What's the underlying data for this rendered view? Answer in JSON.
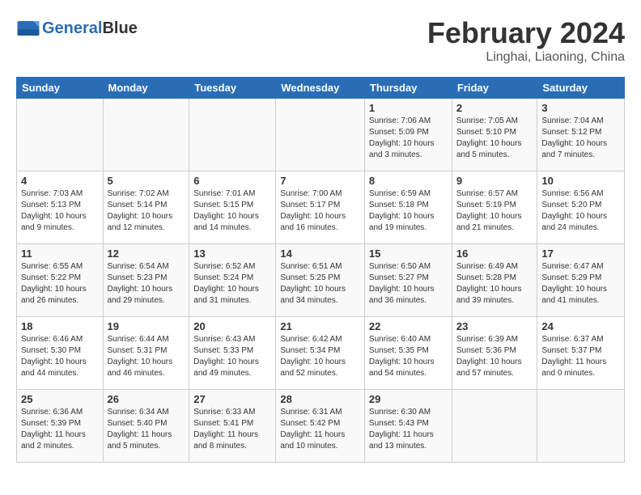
{
  "header": {
    "logo_line1": "General",
    "logo_line2": "Blue",
    "month": "February 2024",
    "location": "Linghai, Liaoning, China"
  },
  "days_of_week": [
    "Sunday",
    "Monday",
    "Tuesday",
    "Wednesday",
    "Thursday",
    "Friday",
    "Saturday"
  ],
  "weeks": [
    [
      {
        "day": "",
        "content": ""
      },
      {
        "day": "",
        "content": ""
      },
      {
        "day": "",
        "content": ""
      },
      {
        "day": "",
        "content": ""
      },
      {
        "day": "1",
        "content": "Sunrise: 7:06 AM\nSunset: 5:09 PM\nDaylight: 10 hours\nand 3 minutes."
      },
      {
        "day": "2",
        "content": "Sunrise: 7:05 AM\nSunset: 5:10 PM\nDaylight: 10 hours\nand 5 minutes."
      },
      {
        "day": "3",
        "content": "Sunrise: 7:04 AM\nSunset: 5:12 PM\nDaylight: 10 hours\nand 7 minutes."
      }
    ],
    [
      {
        "day": "4",
        "content": "Sunrise: 7:03 AM\nSunset: 5:13 PM\nDaylight: 10 hours\nand 9 minutes."
      },
      {
        "day": "5",
        "content": "Sunrise: 7:02 AM\nSunset: 5:14 PM\nDaylight: 10 hours\nand 12 minutes."
      },
      {
        "day": "6",
        "content": "Sunrise: 7:01 AM\nSunset: 5:15 PM\nDaylight: 10 hours\nand 14 minutes."
      },
      {
        "day": "7",
        "content": "Sunrise: 7:00 AM\nSunset: 5:17 PM\nDaylight: 10 hours\nand 16 minutes."
      },
      {
        "day": "8",
        "content": "Sunrise: 6:59 AM\nSunset: 5:18 PM\nDaylight: 10 hours\nand 19 minutes."
      },
      {
        "day": "9",
        "content": "Sunrise: 6:57 AM\nSunset: 5:19 PM\nDaylight: 10 hours\nand 21 minutes."
      },
      {
        "day": "10",
        "content": "Sunrise: 6:56 AM\nSunset: 5:20 PM\nDaylight: 10 hours\nand 24 minutes."
      }
    ],
    [
      {
        "day": "11",
        "content": "Sunrise: 6:55 AM\nSunset: 5:22 PM\nDaylight: 10 hours\nand 26 minutes."
      },
      {
        "day": "12",
        "content": "Sunrise: 6:54 AM\nSunset: 5:23 PM\nDaylight: 10 hours\nand 29 minutes."
      },
      {
        "day": "13",
        "content": "Sunrise: 6:52 AM\nSunset: 5:24 PM\nDaylight: 10 hours\nand 31 minutes."
      },
      {
        "day": "14",
        "content": "Sunrise: 6:51 AM\nSunset: 5:25 PM\nDaylight: 10 hours\nand 34 minutes."
      },
      {
        "day": "15",
        "content": "Sunrise: 6:50 AM\nSunset: 5:27 PM\nDaylight: 10 hours\nand 36 minutes."
      },
      {
        "day": "16",
        "content": "Sunrise: 6:49 AM\nSunset: 5:28 PM\nDaylight: 10 hours\nand 39 minutes."
      },
      {
        "day": "17",
        "content": "Sunrise: 6:47 AM\nSunset: 5:29 PM\nDaylight: 10 hours\nand 41 minutes."
      }
    ],
    [
      {
        "day": "18",
        "content": "Sunrise: 6:46 AM\nSunset: 5:30 PM\nDaylight: 10 hours\nand 44 minutes."
      },
      {
        "day": "19",
        "content": "Sunrise: 6:44 AM\nSunset: 5:31 PM\nDaylight: 10 hours\nand 46 minutes."
      },
      {
        "day": "20",
        "content": "Sunrise: 6:43 AM\nSunset: 5:33 PM\nDaylight: 10 hours\nand 49 minutes."
      },
      {
        "day": "21",
        "content": "Sunrise: 6:42 AM\nSunset: 5:34 PM\nDaylight: 10 hours\nand 52 minutes."
      },
      {
        "day": "22",
        "content": "Sunrise: 6:40 AM\nSunset: 5:35 PM\nDaylight: 10 hours\nand 54 minutes."
      },
      {
        "day": "23",
        "content": "Sunrise: 6:39 AM\nSunset: 5:36 PM\nDaylight: 10 hours\nand 57 minutes."
      },
      {
        "day": "24",
        "content": "Sunrise: 6:37 AM\nSunset: 5:37 PM\nDaylight: 11 hours\nand 0 minutes."
      }
    ],
    [
      {
        "day": "25",
        "content": "Sunrise: 6:36 AM\nSunset: 5:39 PM\nDaylight: 11 hours\nand 2 minutes."
      },
      {
        "day": "26",
        "content": "Sunrise: 6:34 AM\nSunset: 5:40 PM\nDaylight: 11 hours\nand 5 minutes."
      },
      {
        "day": "27",
        "content": "Sunrise: 6:33 AM\nSunset: 5:41 PM\nDaylight: 11 hours\nand 8 minutes."
      },
      {
        "day": "28",
        "content": "Sunrise: 6:31 AM\nSunset: 5:42 PM\nDaylight: 11 hours\nand 10 minutes."
      },
      {
        "day": "29",
        "content": "Sunrise: 6:30 AM\nSunset: 5:43 PM\nDaylight: 11 hours\nand 13 minutes."
      },
      {
        "day": "",
        "content": ""
      },
      {
        "day": "",
        "content": ""
      }
    ]
  ]
}
